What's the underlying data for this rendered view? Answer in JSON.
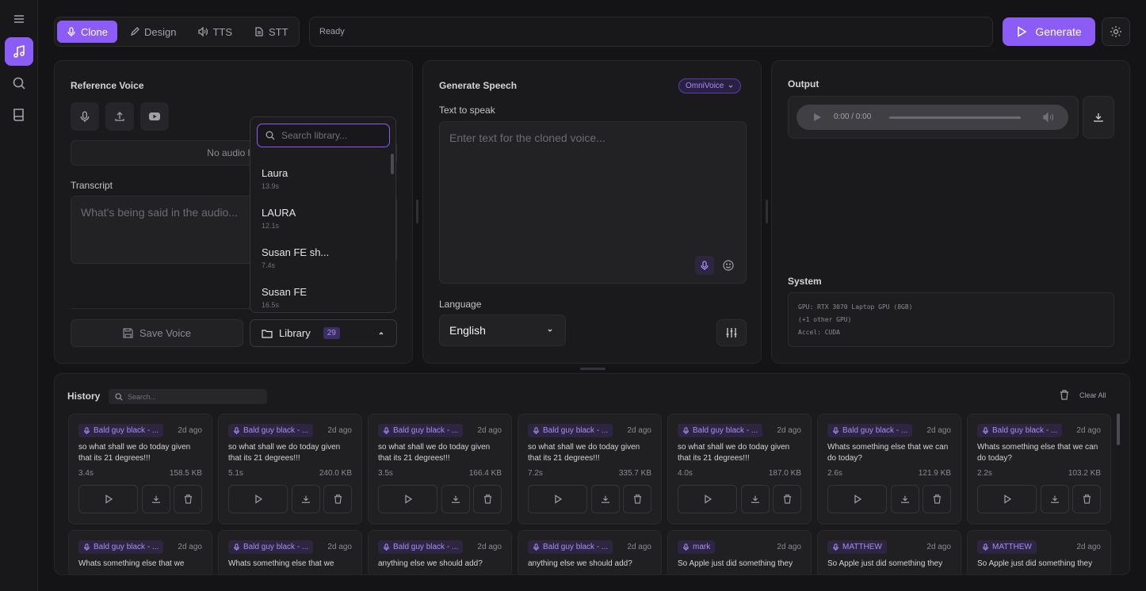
{
  "tabs": [
    {
      "label": "Clone"
    },
    {
      "label": "Design"
    },
    {
      "label": "TTS"
    },
    {
      "label": "STT"
    }
  ],
  "status": "Ready",
  "generate_label": "Generate",
  "reference": {
    "title": "Reference Voice",
    "no_audio": "No audio loa",
    "transcript_label": "Transcript",
    "transcript_placeholder": "What's being said in the audio...",
    "save_label": "Save Voice",
    "library_label": "Library",
    "library_count": "29"
  },
  "library": {
    "search_placeholder": "Search library...",
    "items": [
      {
        "name": "Laura",
        "dur": "13.9s"
      },
      {
        "name": "LAURA",
        "dur": "12.1s"
      },
      {
        "name": "Susan FE sh...",
        "dur": "7.4s"
      },
      {
        "name": "Susan FE",
        "dur": "16.5s"
      }
    ]
  },
  "speech": {
    "title": "Generate Speech",
    "model": "OmniVoice",
    "text_label": "Text to speak",
    "placeholder": "Enter text for the cloned voice...",
    "language_label": "Language",
    "language": "English"
  },
  "output": {
    "title": "Output",
    "time": "0:00 / 0:00",
    "system_title": "System",
    "sys_lines": [
      "GPU: RTX 3070 Laptop GPU (8GB)",
      "(+1 other GPU)",
      "Accel: CUDA"
    ]
  },
  "history": {
    "title": "History",
    "search_placeholder": "Search...",
    "clear_label": "Clear All",
    "cards": [
      {
        "voice": "Bald guy black - ...",
        "ago": "2d ago",
        "text": "so what shall we do today given that its 21 degrees!!!",
        "dur": "3.4s",
        "size": "158.5 KB"
      },
      {
        "voice": "Bald guy black - ...",
        "ago": "2d ago",
        "text": "so what shall we do today given that its 21 degrees!!!",
        "dur": "5.1s",
        "size": "240.0 KB"
      },
      {
        "voice": "Bald guy black - ...",
        "ago": "2d ago",
        "text": "so what shall we do today given that its 21 degrees!!!",
        "dur": "3.5s",
        "size": "166.4 KB"
      },
      {
        "voice": "Bald guy black - ...",
        "ago": "2d ago",
        "text": "so what shall we do today given that its 21 degrees!!!",
        "dur": "7.2s",
        "size": "335.7 KB"
      },
      {
        "voice": "Bald guy black - ...",
        "ago": "2d ago",
        "text": "so what shall we do today given that its 21 degrees!!!",
        "dur": "4.0s",
        "size": "187.0 KB"
      },
      {
        "voice": "Bald guy black - ...",
        "ago": "2d ago",
        "text": "Whats something else that we can do today?",
        "dur": "2.6s",
        "size": "121.9 KB"
      },
      {
        "voice": "Bald guy black - ...",
        "ago": "2d ago",
        "text": "Whats something else that we can do today?",
        "dur": "2.2s",
        "size": "103.2 KB"
      }
    ],
    "cards2": [
      {
        "voice": "Bald guy black - ...",
        "ago": "2d ago",
        "text": "Whats something else that we"
      },
      {
        "voice": "Bald guy black - ...",
        "ago": "2d ago",
        "text": "Whats something else that we"
      },
      {
        "voice": "Bald guy black - ...",
        "ago": "2d ago",
        "text": "anything else we should add?"
      },
      {
        "voice": "Bald guy black - ...",
        "ago": "2d ago",
        "text": "anything else we should add?"
      },
      {
        "voice": "mark",
        "ago": "2d ago",
        "text": "So Apple just did something they"
      },
      {
        "voice": "MATTHEW",
        "ago": "2d ago",
        "text": "So Apple just did something they"
      },
      {
        "voice": "MATTHEW",
        "ago": "2d ago",
        "text": "So Apple just did something they"
      }
    ]
  },
  "colors": {
    "accent": "#8b5cf6",
    "bg": "#141416",
    "panel": "#1a1a1d"
  }
}
